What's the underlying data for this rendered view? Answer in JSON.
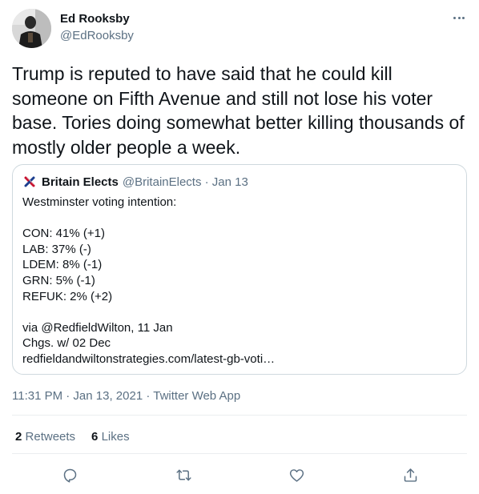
{
  "author": {
    "name": "Ed Rooksby",
    "handle": "@EdRooksby"
  },
  "tweet": {
    "text": "Trump is reputed to have said that he could kill someone on Fifth Avenue and still not lose his voter base. Tories doing somewhat better killing thousands of mostly older people a week."
  },
  "quote": {
    "name": "Britain Elects",
    "meta": "@BritainElects · Jan 13",
    "lines": [
      "Westminster voting intention:",
      "",
      "CON: 41% (+1)",
      "LAB: 37% (-)",
      "LDEM: 8% (-1)",
      "GRN: 5% (-1)",
      "REFUK: 2% (+2)",
      "",
      "via @RedfieldWilton, 11 Jan",
      "Chgs. w/ 02 Dec",
      "redfieldandwiltonstrategies.com/latest-gb-voti…"
    ]
  },
  "timestamp": {
    "time": "11:31 PM · Jan 13, 2021",
    "separator": " · ",
    "source": "Twitter Web App"
  },
  "stats": {
    "retweets_count": "2",
    "retweets_label": "Retweets",
    "likes_count": "6",
    "likes_label": "Likes"
  },
  "icons": {
    "more": "more-icon",
    "reply": "reply-icon",
    "retweet": "retweet-icon",
    "like": "like-icon",
    "share": "share-icon"
  },
  "colors": {
    "secondary_text": "#5b7083",
    "border": "#cfd9de",
    "divider": "#ebeef0"
  }
}
